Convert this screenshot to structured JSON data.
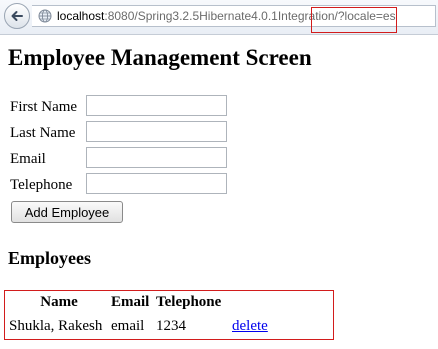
{
  "browser": {
    "url_host": "localhost",
    "url_rest": ":8080/Spring3.2.5Hibernate4.0.1Integration/?locale=es"
  },
  "page": {
    "title": "Employee Management Screen"
  },
  "form": {
    "fields": [
      {
        "label": "First Name",
        "value": ""
      },
      {
        "label": "Last Name",
        "value": ""
      },
      {
        "label": "Email",
        "value": ""
      },
      {
        "label": "Telephone",
        "value": ""
      }
    ],
    "submit_label": "Add Employee"
  },
  "employees": {
    "title": "Employees",
    "columns": [
      "Name",
      "Email",
      "Telephone"
    ],
    "rows": [
      {
        "name": "Shukla, Rakesh",
        "email": "email",
        "telephone": "1234",
        "action": "delete"
      }
    ]
  },
  "colors": {
    "highlight_border": "#d21c1c",
    "link": "#0000ee"
  }
}
